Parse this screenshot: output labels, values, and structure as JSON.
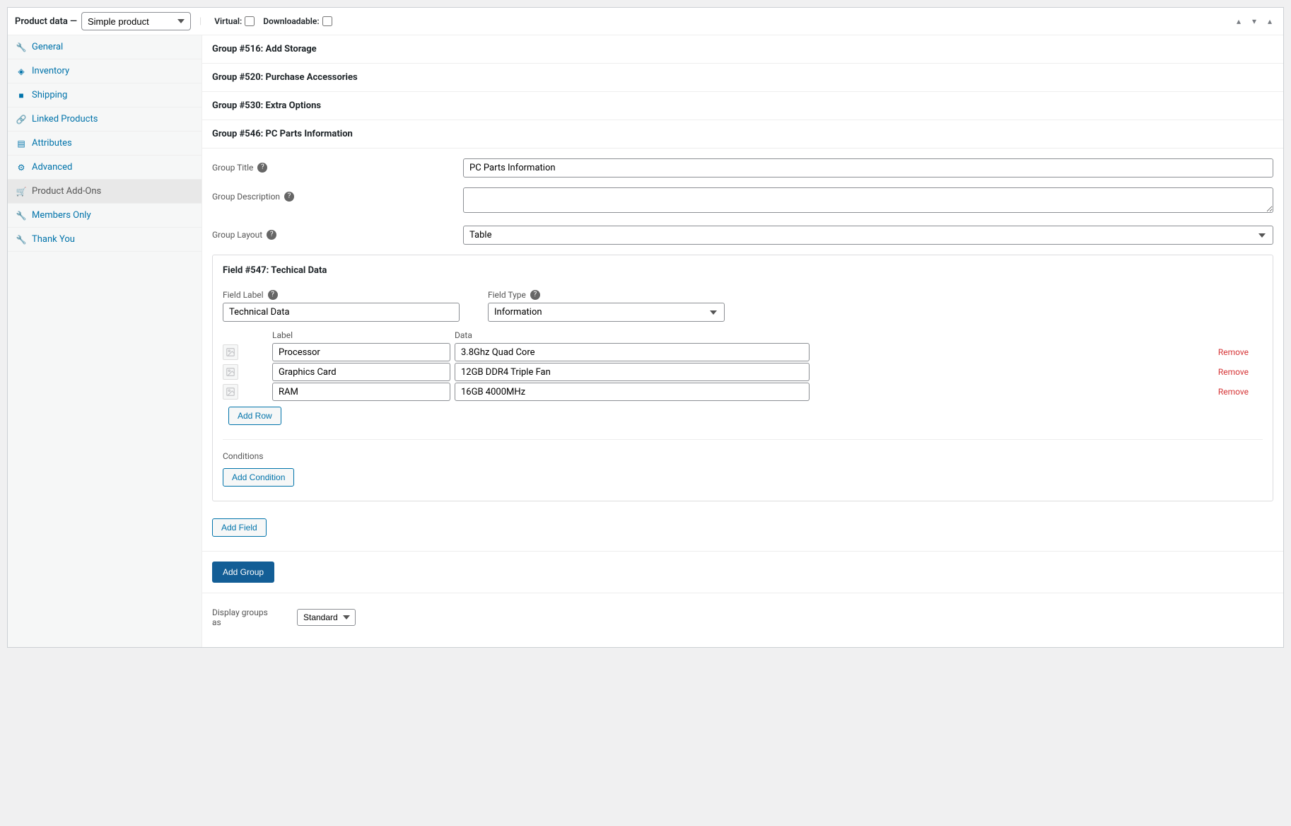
{
  "header": {
    "title": "Product data —",
    "product_type": "Simple product",
    "virtual_label": "Virtual:",
    "downloadable_label": "Downloadable:"
  },
  "sidebar": {
    "items": [
      {
        "label": "General",
        "icon": "wrench"
      },
      {
        "label": "Inventory",
        "icon": "tag"
      },
      {
        "label": "Shipping",
        "icon": "truck"
      },
      {
        "label": "Linked Products",
        "icon": "link"
      },
      {
        "label": "Attributes",
        "icon": "list"
      },
      {
        "label": "Advanced",
        "icon": "gear"
      },
      {
        "label": "Product Add-Ons",
        "icon": "cart"
      },
      {
        "label": "Members Only",
        "icon": "wrench"
      },
      {
        "label": "Thank You",
        "icon": "wrench"
      }
    ],
    "active_index": 6
  },
  "groups": {
    "collapsed": [
      "Group #516: Add Storage",
      "Group #520: Purchase Accessories",
      "Group #530: Extra Options"
    ],
    "expanded": {
      "header": "Group #546: PC Parts Information",
      "title_label": "Group Title",
      "title_value": "PC Parts Information",
      "description_label": "Group Description",
      "description_value": "",
      "layout_label": "Group Layout",
      "layout_value": "Table"
    }
  },
  "field": {
    "header": "Field #547: Techical Data",
    "label_label": "Field Label",
    "label_value": "Technical Data",
    "type_label": "Field Type",
    "type_value": "Information",
    "table": {
      "col_label": "Label",
      "col_data": "Data",
      "rows": [
        {
          "label": "Processor",
          "data": "3.8Ghz Quad Core"
        },
        {
          "label": "Graphics Card",
          "data": "12GB DDR4 Triple Fan"
        },
        {
          "label": "RAM",
          "data": "16GB 4000MHz"
        }
      ],
      "remove_label": "Remove"
    },
    "add_row_label": "Add Row",
    "conditions_label": "Conditions",
    "add_condition_label": "Add Condition"
  },
  "buttons": {
    "add_field": "Add Field",
    "add_group": "Add Group"
  },
  "display": {
    "label": "Display groups as",
    "value": "Standard"
  }
}
